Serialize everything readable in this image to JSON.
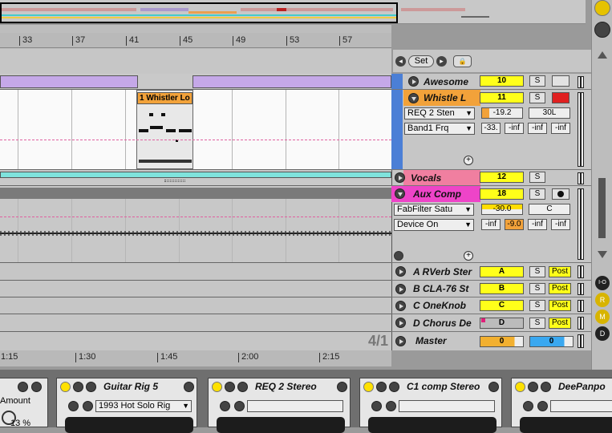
{
  "ruler": {
    "bars": [
      "33",
      "37",
      "41",
      "45",
      "49",
      "53",
      "57"
    ]
  },
  "timeline": {
    "times": [
      "1:15",
      "1:30",
      "1:45",
      "2:00",
      "2:15"
    ],
    "position": "4/1"
  },
  "transport": {
    "set_label": "Set"
  },
  "clip": {
    "name": "1 Whistler Lo"
  },
  "tracks": [
    {
      "name": "Awesome",
      "number": "10",
      "color": "#c5a8e8"
    },
    {
      "name": "Whistle L",
      "number": "11",
      "color": "#f2a23a",
      "device1": "REQ 2 Sten",
      "device2": "Band1 Frq",
      "volume": "-19.2",
      "pan": "30L",
      "sends": [
        "-33.",
        "-inf",
        "-inf",
        "-inf"
      ]
    },
    {
      "name": "Vocals",
      "number": "12",
      "color": "#f07fa0"
    },
    {
      "name": "Aux Comp",
      "number": "18",
      "color": "#ee44c8",
      "device1": "FabFilter Satu",
      "device2": "Device On",
      "volume": "-30.0",
      "pan": "C",
      "sends": [
        "-inf",
        "-9.0",
        "-inf",
        "-inf"
      ]
    }
  ],
  "returns": [
    {
      "name": "A RVerb Ster",
      "letter": "A",
      "post": "Post"
    },
    {
      "name": "B CLA-76 St",
      "letter": "B",
      "post": "Post"
    },
    {
      "name": "C OneKnob",
      "letter": "C",
      "post": "Post"
    },
    {
      "name": "D Chorus De",
      "letter": "D",
      "post": "Post"
    }
  ],
  "master": {
    "name": "Master",
    "vol": "0",
    "pan": "0"
  },
  "mixer_labels": {
    "solo": "S"
  },
  "rightbar": {
    "io": "I-O",
    "r": "R",
    "m": "M",
    "d": "D"
  },
  "devices": {
    "amount_label": "Amount",
    "amount_value": "13 %",
    "guitar_rig": {
      "title": "Guitar Rig 5",
      "preset": "1993 Hot Solo Rig"
    },
    "req": {
      "title": "REQ 2 Stereo"
    },
    "c1": {
      "title": "C1 comp Stereo"
    },
    "deepan": {
      "title": "DeePanpo"
    }
  }
}
